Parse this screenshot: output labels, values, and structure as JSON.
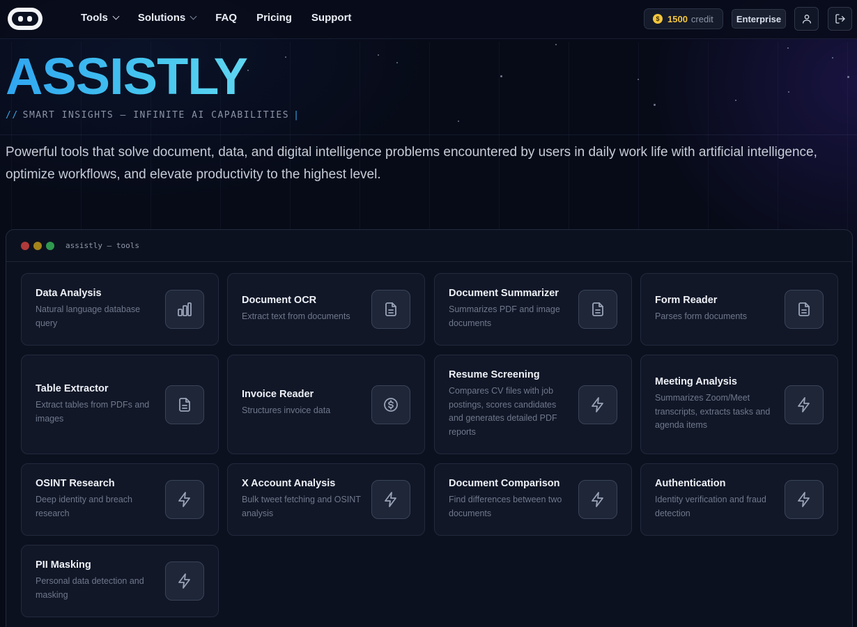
{
  "header": {
    "nav": [
      {
        "label": "Tools",
        "dropdown": true
      },
      {
        "label": "Solutions",
        "dropdown": true
      },
      {
        "label": "FAQ",
        "dropdown": false
      },
      {
        "label": "Pricing",
        "dropdown": false
      },
      {
        "label": "Support",
        "dropdown": false
      }
    ],
    "credit_amount": "1500",
    "credit_label": "credit",
    "enterprise_label": "Enterprise"
  },
  "hero": {
    "brand": "ASSISTLY",
    "tagline_prefix": "//",
    "tagline": "SMART INSIGHTS – INFINITE AI CAPABILITIES",
    "tagline_cursor": "|",
    "description": "Powerful tools that solve document, data, and digital intelligence problems encountered by users in daily work life with artificial intelligence, optimize workflows, and elevate productivity to the highest level."
  },
  "window": {
    "title": "assistly — tools",
    "dot_colors": [
      "#b03a3a",
      "#a3841a",
      "#2f9a4f"
    ]
  },
  "tools": [
    {
      "title": "Data Analysis",
      "description": "Natural language database query",
      "icon": "bar-chart-icon"
    },
    {
      "title": "Document OCR",
      "description": "Extract text from documents",
      "icon": "document-icon"
    },
    {
      "title": "Document Summarizer",
      "description": "Summarizes PDF and image documents",
      "icon": "document-icon"
    },
    {
      "title": "Form Reader",
      "description": "Parses form documents",
      "icon": "document-icon"
    },
    {
      "title": "Table Extractor",
      "description": "Extract tables from PDFs and images",
      "icon": "document-icon"
    },
    {
      "title": "Invoice Reader",
      "description": "Structures invoice data",
      "icon": "dollar-icon"
    },
    {
      "title": "Resume Screening",
      "description": "Compares CV files with job postings, scores candidates and generates detailed PDF reports",
      "icon": "lightning-icon"
    },
    {
      "title": "Meeting Analysis",
      "description": "Summarizes Zoom/Meet transcripts, extracts tasks and agenda items",
      "icon": "lightning-icon"
    },
    {
      "title": "OSINT Research",
      "description": "Deep identity and breach research",
      "icon": "lightning-icon"
    },
    {
      "title": "X Account Analysis",
      "description": "Bulk tweet fetching and OSINT analysis",
      "icon": "lightning-icon"
    },
    {
      "title": "Document Comparison",
      "description": "Find differences between two documents",
      "icon": "lightning-icon"
    },
    {
      "title": "Authentication",
      "description": "Identity verification and fraud detection",
      "icon": "lightning-icon"
    },
    {
      "title": "PII Masking",
      "description": "Personal data detection and masking",
      "icon": "lightning-icon"
    }
  ],
  "colors": {
    "accent": "#3ab6f0",
    "coin": "#f3c63e",
    "background": "#070b18"
  }
}
